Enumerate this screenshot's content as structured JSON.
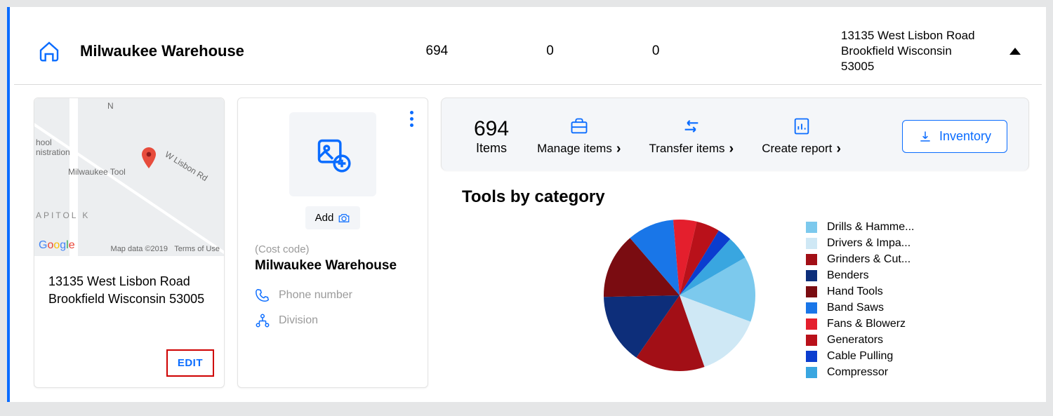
{
  "summary": {
    "title": "Milwaukee Warehouse",
    "stats": [
      "694",
      "0",
      "0"
    ],
    "address_line1": "13135 West Lisbon Road",
    "address_line2": "Brookfield Wisconsin 53005"
  },
  "map_card": {
    "labels": {
      "school": "hool",
      "admin": "nistration",
      "road": "W Lisbon Rd",
      "tool": "Milwaukee Tool",
      "neigh": "APITOL K",
      "n": "N"
    },
    "attrib_data": "Map data ©2019",
    "attrib_terms": "Terms of Use",
    "address_line1": "13135 West Lisbon Road",
    "address_line2": "Brookfield Wisconsin 53005",
    "edit_label": "EDIT"
  },
  "info_card": {
    "add_label": "Add",
    "cost_code": "(Cost code)",
    "title": "Milwaukee Warehouse",
    "phone_placeholder": "Phone number",
    "division_placeholder": "Division"
  },
  "panel": {
    "items_count": "694",
    "items_label": "Items",
    "manage_label": "Manage items",
    "transfer_label": "Transfer items",
    "report_label": "Create report",
    "inventory_label": "Inventory",
    "chart_title": "Tools by category"
  },
  "legend": [
    {
      "color": "#7cc9ed",
      "label": "Drills & Hamme..."
    },
    {
      "color": "#cfe8f5",
      "label": "Drivers & Impa..."
    },
    {
      "color": "#a20f16",
      "label": "Grinders & Cut..."
    },
    {
      "color": "#0d2e7a",
      "label": "Benders"
    },
    {
      "color": "#7a0c11",
      "label": "Hand Tools"
    },
    {
      "color": "#1976e8",
      "label": "Band Saws"
    },
    {
      "color": "#e41f2d",
      "label": "Fans & Blowerz"
    },
    {
      "color": "#b9111a",
      "label": "Generators"
    },
    {
      "color": "#0b3dcf",
      "label": "Cable Pulling"
    },
    {
      "color": "#39a6e0",
      "label": "Compressor"
    }
  ],
  "chart_data": {
    "type": "pie",
    "title": "Tools by category",
    "categories": [
      "Drills & Hammers",
      "Drivers & Impacts",
      "Grinders & Cutters",
      "Benders",
      "Hand Tools",
      "Band Saws",
      "Fans & Blowers",
      "Generators",
      "Cable Pulling",
      "Compressor"
    ],
    "values": [
      14,
      14,
      15,
      15,
      14,
      10,
      5,
      5,
      3,
      5
    ],
    "series": [
      {
        "name": "Drills & Hammers",
        "value": 14,
        "color": "#7cc9ed"
      },
      {
        "name": "Drivers & Impacts",
        "value": 14,
        "color": "#cfe8f5"
      },
      {
        "name": "Grinders & Cutters",
        "value": 15,
        "color": "#a20f16"
      },
      {
        "name": "Benders",
        "value": 15,
        "color": "#0d2e7a"
      },
      {
        "name": "Hand Tools",
        "value": 14,
        "color": "#7a0c11"
      },
      {
        "name": "Band Saws",
        "value": 10,
        "color": "#1976e8"
      },
      {
        "name": "Fans & Blowers",
        "value": 5,
        "color": "#e41f2d"
      },
      {
        "name": "Generators",
        "value": 5,
        "color": "#b9111a"
      },
      {
        "name": "Cable Pulling",
        "value": 3,
        "color": "#0b3dcf"
      },
      {
        "name": "Compressor",
        "value": 5,
        "color": "#39a6e0"
      }
    ]
  }
}
